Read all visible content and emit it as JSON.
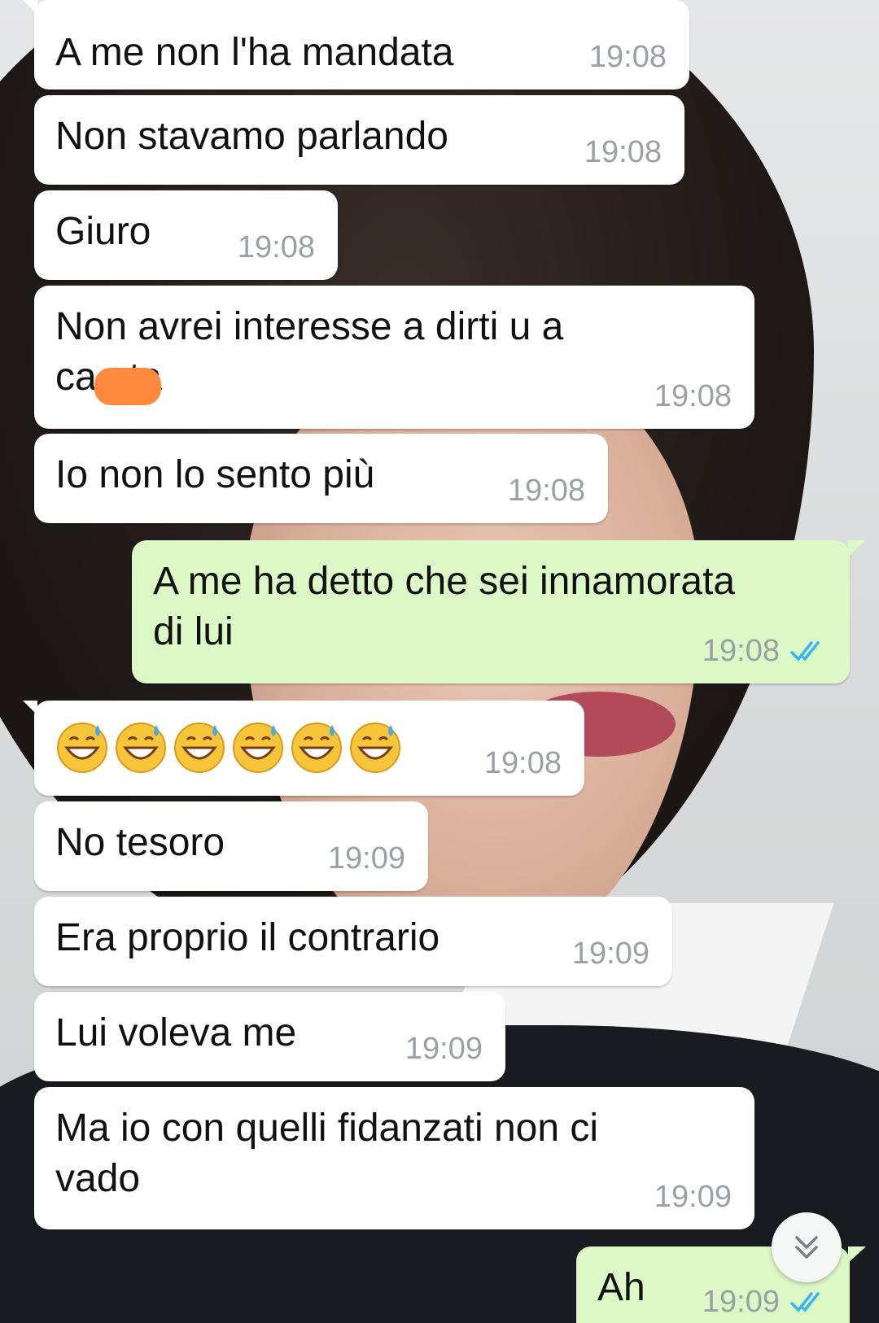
{
  "messages": [
    {
      "text": "A me non l'ha mandata",
      "time": "19:08"
    },
    {
      "text": "Non stavamo parlando",
      "time": "19:08"
    },
    {
      "text": "Giuro",
      "time": "19:08"
    },
    {
      "text": "Non avrei interesse a dirti u a\nca        ata",
      "time": "19:08"
    },
    {
      "text": "Io non lo sento più",
      "time": "19:08"
    },
    {
      "text": "A me ha detto che sei innamorata\ndi lui",
      "time": "19:08"
    },
    {
      "text": "",
      "time": "19:08"
    },
    {
      "text": "No tesoro",
      "time": "19:09"
    },
    {
      "text": "Era proprio il contrario",
      "time": "19:09"
    },
    {
      "text": "Lui voleva me",
      "time": "19:09"
    },
    {
      "text": "Ma io con quelli fidanzati non ci\nvado",
      "time": "19:09"
    },
    {
      "text": "Ah",
      "time": "19:09"
    }
  ],
  "icons": {
    "read_receipt": "double-check-icon",
    "emoji": "grinning-sweat-emoji-icon",
    "scroll": "chevron-double-down-icon"
  },
  "colors": {
    "incoming_bubble": "#ffffff",
    "outgoing_bubble": "#dcf8c6",
    "read_tick": "#34b7f1",
    "timestamp": "#9aa0a4"
  }
}
